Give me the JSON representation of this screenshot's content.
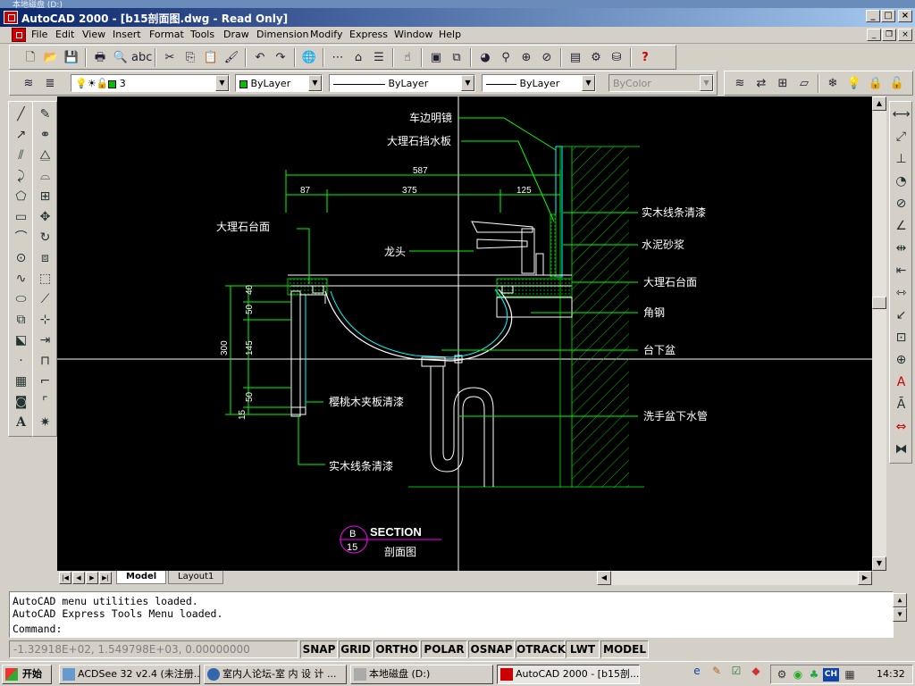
{
  "background_window": {
    "title": "本地磁盘 (D:)"
  },
  "window": {
    "title": "AutoCAD 2000 - [b15剖面图.dwg - Read Only]"
  },
  "menu": [
    "File",
    "Edit",
    "View",
    "Insert",
    "Format",
    "Tools",
    "Draw",
    "Dimension",
    "Modify",
    "Express",
    "Window",
    "Help"
  ],
  "layer_bar": {
    "layer_name": "3",
    "color": "ByLayer",
    "linetype": "ByLayer",
    "lineweight": "ByLayer",
    "plotstyle": "ByColor"
  },
  "drawing": {
    "labels": {
      "mirror": "车边明镜",
      "backsplash": "大理石挡水板",
      "countertop_left": "大理石台面",
      "faucet": "龙头",
      "wood_strip_top": "实木线条清漆",
      "mortar": "水泥砂浆",
      "countertop_right": "大理石台面",
      "angle_steel": "角钢",
      "undermount_basin": "台下盆",
      "cherry_panel": "樱桃木夹板清漆",
      "drain_pipe": "洗手盆下水管",
      "wood_strip_bottom": "实木线条清漆"
    },
    "dims": {
      "overall": "587",
      "left": "87",
      "middle": "375",
      "right": "125",
      "v1": "40",
      "v2": "50",
      "v3": "145",
      "v4": "50",
      "v5": "15",
      "total_height": "300"
    },
    "section": {
      "letter": "B",
      "number": "15",
      "title": "SECTION",
      "subtitle": "剖面图"
    }
  },
  "tabs": {
    "model": "Model",
    "layout": "Layout1"
  },
  "command": {
    "lines": [
      "AutoCAD menu utilities loaded.",
      "AutoCAD Express Tools Menu loaded."
    ],
    "prompt": "Command:"
  },
  "status": {
    "coords": "-1.32918E+02, 1.549798E+03, 0.00000000",
    "toggles": [
      "SNAP",
      "GRID",
      "ORTHO",
      "POLAR",
      "OSNAP",
      "OTRACK",
      "LWT",
      "MODEL"
    ]
  },
  "taskbar": {
    "start": "开始",
    "tasks": [
      "ACDSee 32 v2.4 (未注册...",
      "室内人论坛-室 内 设 计 ...",
      "本地磁盘 (D:)",
      "AutoCAD 2000 - [b15剖..."
    ],
    "tray_lang": "CH",
    "clock": "14:32"
  }
}
